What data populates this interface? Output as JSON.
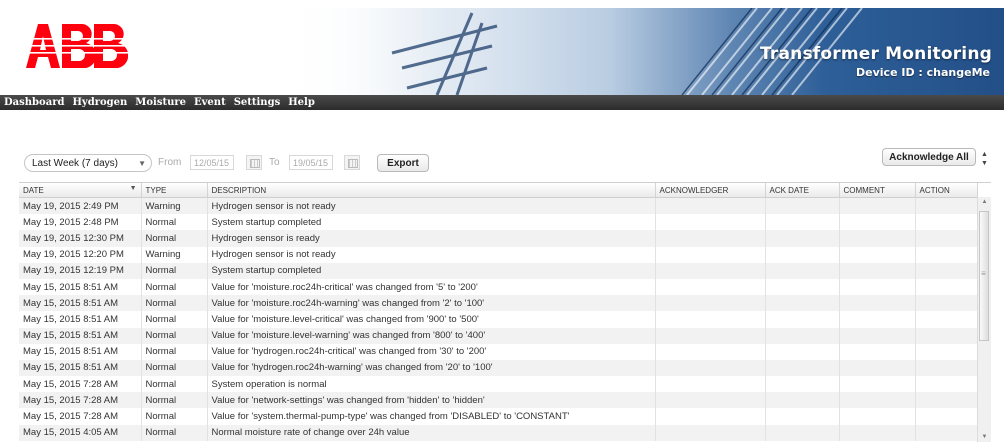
{
  "header": {
    "logo_text": "ABB",
    "app_title": "Transformer Monitoring",
    "device_id": "Device ID : changeMe",
    "brand_red": "#ff000f"
  },
  "nav": {
    "items": [
      {
        "label": "Dashboard"
      },
      {
        "label": "Hydrogen"
      },
      {
        "label": "Moisture"
      },
      {
        "label": "Event"
      },
      {
        "label": "Settings"
      },
      {
        "label": "Help"
      }
    ]
  },
  "toolbar": {
    "period_select": "Last Week (7 days)",
    "from_label": "From",
    "from_date": "12/05/15",
    "to_label": "To",
    "to_date": "19/05/15",
    "export_label": "Export",
    "acknowledge_all_label": "Acknowledge All"
  },
  "table": {
    "columns": [
      {
        "label": "DATE",
        "sorted": "descending"
      },
      {
        "label": "TYPE"
      },
      {
        "label": "DESCRIPTION"
      },
      {
        "label": "ACKNOWLEDGER"
      },
      {
        "label": "ACK DATE"
      },
      {
        "label": "COMMENT"
      },
      {
        "label": "ACTION"
      }
    ],
    "rows": [
      {
        "date": "May 19, 2015 2:49 PM",
        "type": "Warning",
        "description": "Hydrogen sensor is not ready"
      },
      {
        "date": "May 19, 2015 2:48 PM",
        "type": "Normal",
        "description": "System startup completed"
      },
      {
        "date": "May 19, 2015 12:30 PM",
        "type": "Normal",
        "description": "Hydrogen sensor is ready"
      },
      {
        "date": "May 19, 2015 12:20 PM",
        "type": "Warning",
        "description": "Hydrogen sensor is not ready"
      },
      {
        "date": "May 19, 2015 12:19 PM",
        "type": "Normal",
        "description": "System startup completed"
      },
      {
        "date": "May 15, 2015 8:51 AM",
        "type": "Normal",
        "description": "Value for 'moisture.roc24h-critical' was changed from '5' to '200'"
      },
      {
        "date": "May 15, 2015 8:51 AM",
        "type": "Normal",
        "description": "Value for 'moisture.roc24h-warning' was changed from '2' to '100'"
      },
      {
        "date": "May 15, 2015 8:51 AM",
        "type": "Normal",
        "description": "Value for 'moisture.level-critical' was changed from '900' to '500'"
      },
      {
        "date": "May 15, 2015 8:51 AM",
        "type": "Normal",
        "description": "Value for 'moisture.level-warning' was changed from '800' to '400'"
      },
      {
        "date": "May 15, 2015 8:51 AM",
        "type": "Normal",
        "description": "Value for 'hydrogen.roc24h-critical' was changed from '30' to '200'"
      },
      {
        "date": "May 15, 2015 8:51 AM",
        "type": "Normal",
        "description": "Value for 'hydrogen.roc24h-warning' was changed from '20' to '100'"
      },
      {
        "date": "May 15, 2015 7:28 AM",
        "type": "Normal",
        "description": "System operation is normal"
      },
      {
        "date": "May 15, 2015 7:28 AM",
        "type": "Normal",
        "description": "Value for 'network-settings' was changed from 'hidden' to 'hidden'"
      },
      {
        "date": "May 15, 2015 7:28 AM",
        "type": "Normal",
        "description": "Value for 'system.thermal-pump-type' was changed from 'DISABLED' to 'CONSTANT'"
      },
      {
        "date": "May 15, 2015 4:05 AM",
        "type": "Normal",
        "description": "Normal moisture rate of change over 24h value"
      }
    ]
  }
}
